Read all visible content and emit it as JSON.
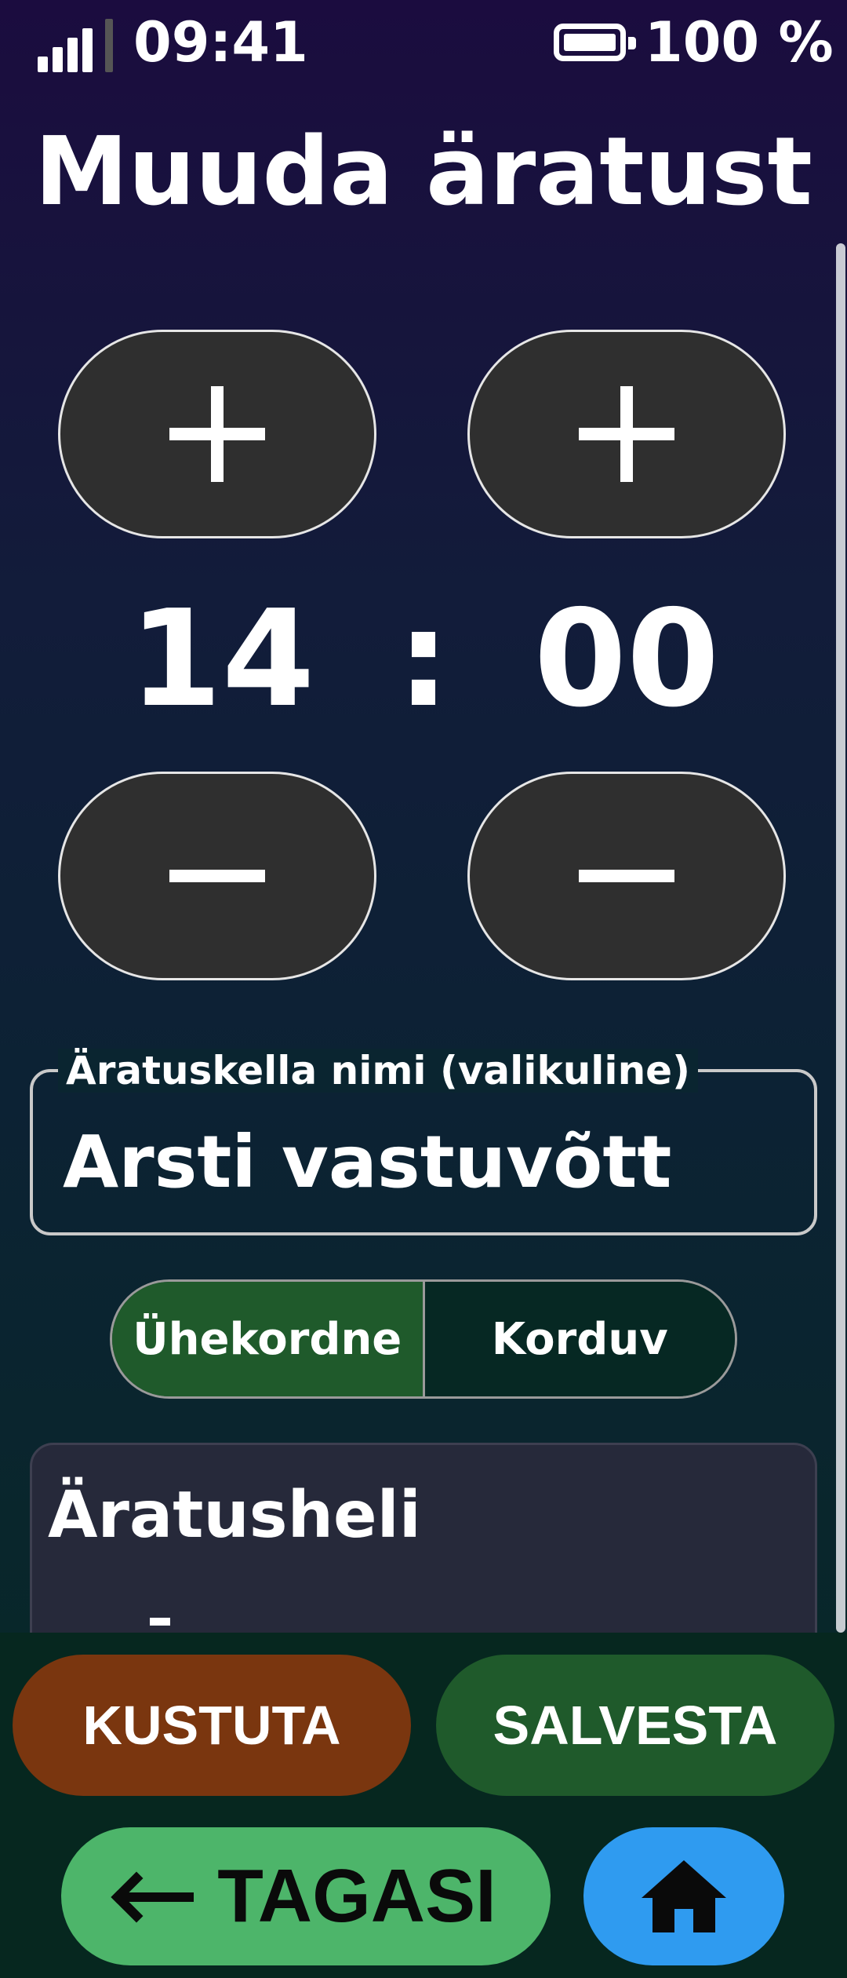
{
  "status_bar": {
    "time": "09:41",
    "battery": "100 %",
    "signal_icon": "signal-bars-icon",
    "battery_icon": "battery-full-icon"
  },
  "page": {
    "title": "Muuda äratust"
  },
  "time_picker": {
    "hours": "14",
    "separator": ":",
    "minutes": "00",
    "increment_icon": "plus-icon",
    "decrement_icon": "minus-icon"
  },
  "name_field": {
    "label": "Äratuskella nimi (valikuline)",
    "value": "Arsti vastuvõtt"
  },
  "repeat_toggle": {
    "options": [
      "Ühekordne",
      "Korduv"
    ],
    "selected": "Ühekordne"
  },
  "sound_section": {
    "title": "Äratusheli"
  },
  "actions": {
    "delete_label": "KUSTUTA",
    "save_label": "SALVESTA",
    "back_label": "TAGASI",
    "back_icon": "arrow-left-icon",
    "home_icon": "home-icon"
  },
  "colors": {
    "delete_button": "#7a360f",
    "save_button": "#1f5a2b",
    "back_button": "#4db56a",
    "home_button": "#2f9bf0",
    "segment_active": "#1f5a2b"
  }
}
